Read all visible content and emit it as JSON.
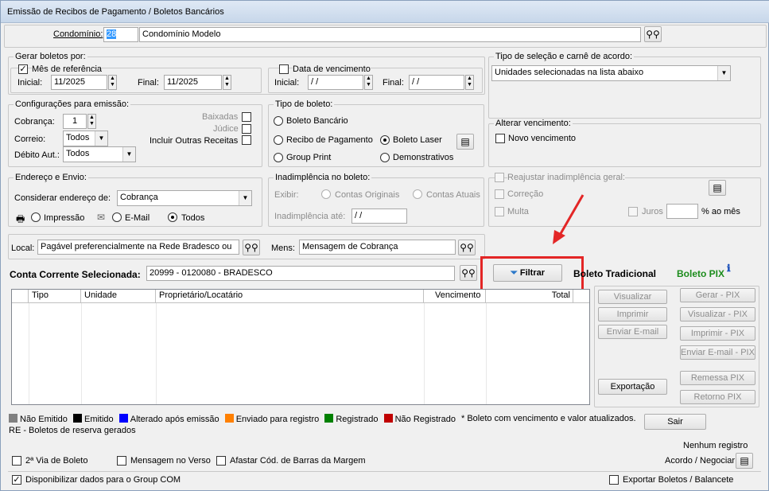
{
  "window": {
    "title": "Emissão de Recibos de Pagamento / Boletos Bancários"
  },
  "condominio": {
    "label": "Condomínio:",
    "code": "28",
    "name": "Condomínio Modelo"
  },
  "gerar": {
    "legend": "Gerar boletos por:",
    "mes_referencia": {
      "label": "Mês de referência",
      "checked": true
    },
    "inicial_label": "Inicial:",
    "inicial_value": "11/2025",
    "final_label": "Final:",
    "final_value": "11/2025",
    "data_vencimento": {
      "label": "Data de vencimento",
      "checked": false
    },
    "dv_inicial_label": "Inicial:",
    "dv_inicial_value": " / /",
    "dv_final_label": "Final:",
    "dv_final_value": " / /"
  },
  "tipo_selecao": {
    "legend": "Tipo de seleção e carnê de acordo:",
    "value": "Unidades selecionadas na lista abaixo"
  },
  "config": {
    "legend": "Configurações para emissão:",
    "cobranca_label": "Cobrança:",
    "cobranca_value": "1",
    "correio_label": "Correio:",
    "correio_value": "Todos",
    "debito_label": "Débito Aut.:",
    "debito_value": "Todos",
    "baixadas": "Baixadas",
    "judice": "Júdice",
    "outras": "Incluir Outras Receitas"
  },
  "tipo_boleto": {
    "legend": "Tipo de boleto:",
    "bancario": "Boleto Bancário",
    "recibo": "Recibo de Pagamento",
    "laser": "Boleto Laser",
    "group_print": "Group Print",
    "demonstrativos": "Demonstrativos"
  },
  "alterar": {
    "legend": "Alterar vencimento:",
    "novo": "Novo vencimento"
  },
  "endereco": {
    "legend": "Endereço e Envio:",
    "considerar_label": "Considerar endereço de:",
    "considerar_value": "Cobrança",
    "impressao": "Impressão",
    "email": "E-Mail",
    "todos": "Todos"
  },
  "inadimplencia": {
    "legend": "Inadimplência no boleto:",
    "exibir": "Exibir:",
    "originais": "Contas Originais",
    "atuais": "Contas Atuais",
    "ate_label": "Inadimplência até:",
    "ate_value": " / /"
  },
  "reajustar": {
    "legend": "Reajustar inadimplência geral:",
    "correcao": "Correção",
    "multa": "Multa",
    "juros": "Juros",
    "ao_mes": "% ao mês"
  },
  "local": {
    "label": "Local:",
    "value": "Pagável preferencialmente na Rede Bradesco ou",
    "mens_label": "Mens:",
    "mens_value": "Mensagem de Cobrança"
  },
  "conta": {
    "label": "Conta Corrente Selecionada:",
    "value": "20999 - 0120080 - BRADESCO"
  },
  "filtrar": "Filtrar",
  "boleto_tradicional": "Boleto Tradicional",
  "boleto_pix": "Boleto PIX",
  "table": {
    "columns": [
      "Tipo",
      "Unidade",
      "Proprietário/Locatário",
      "Vencimento",
      "Total"
    ]
  },
  "actions": {
    "visualizar": "Visualizar",
    "imprimir": "Imprimir",
    "enviar_email": "Enviar E-mail",
    "exportacao": "Exportação",
    "gerar_pix": "Gerar - PIX",
    "visualizar_pix": "Visualizar - PIX",
    "imprimir_pix": "Imprimir - PIX",
    "enviar_pix": "Enviar E-mail - PIX",
    "remessa_pix": "Remessa PIX",
    "retorno_pix": "Retorno PIX"
  },
  "legend_status": [
    {
      "label": "Não Emitido",
      "color": "#808080"
    },
    {
      "label": "Emitido",
      "color": "#000000"
    },
    {
      "label": "Alterado após emissão",
      "color": "#0000ff"
    },
    {
      "label": "Enviado para registro",
      "color": "#ff8000"
    },
    {
      "label": "Registrado",
      "color": "#008000"
    },
    {
      "label": "Não Registrado",
      "color": "#c00000"
    }
  ],
  "note_atualizados": "* Boleto com vencimento e valor atualizados.",
  "note_re": "RE - Boletos de reserva gerados",
  "sair": "Sair",
  "nenhum_registro": "Nenhum registro",
  "acordo": "Acordo / Negociar",
  "bottom": {
    "segunda_via": "2ª Via de Boleto",
    "mensagem_verso": "Mensagem no Verso",
    "afastar": "Afastar Cód. de Barras da Margem",
    "disponibilizar": "Disponibilizar dados para o Group COM",
    "exportar": "Exportar Boletos / Balancete"
  }
}
